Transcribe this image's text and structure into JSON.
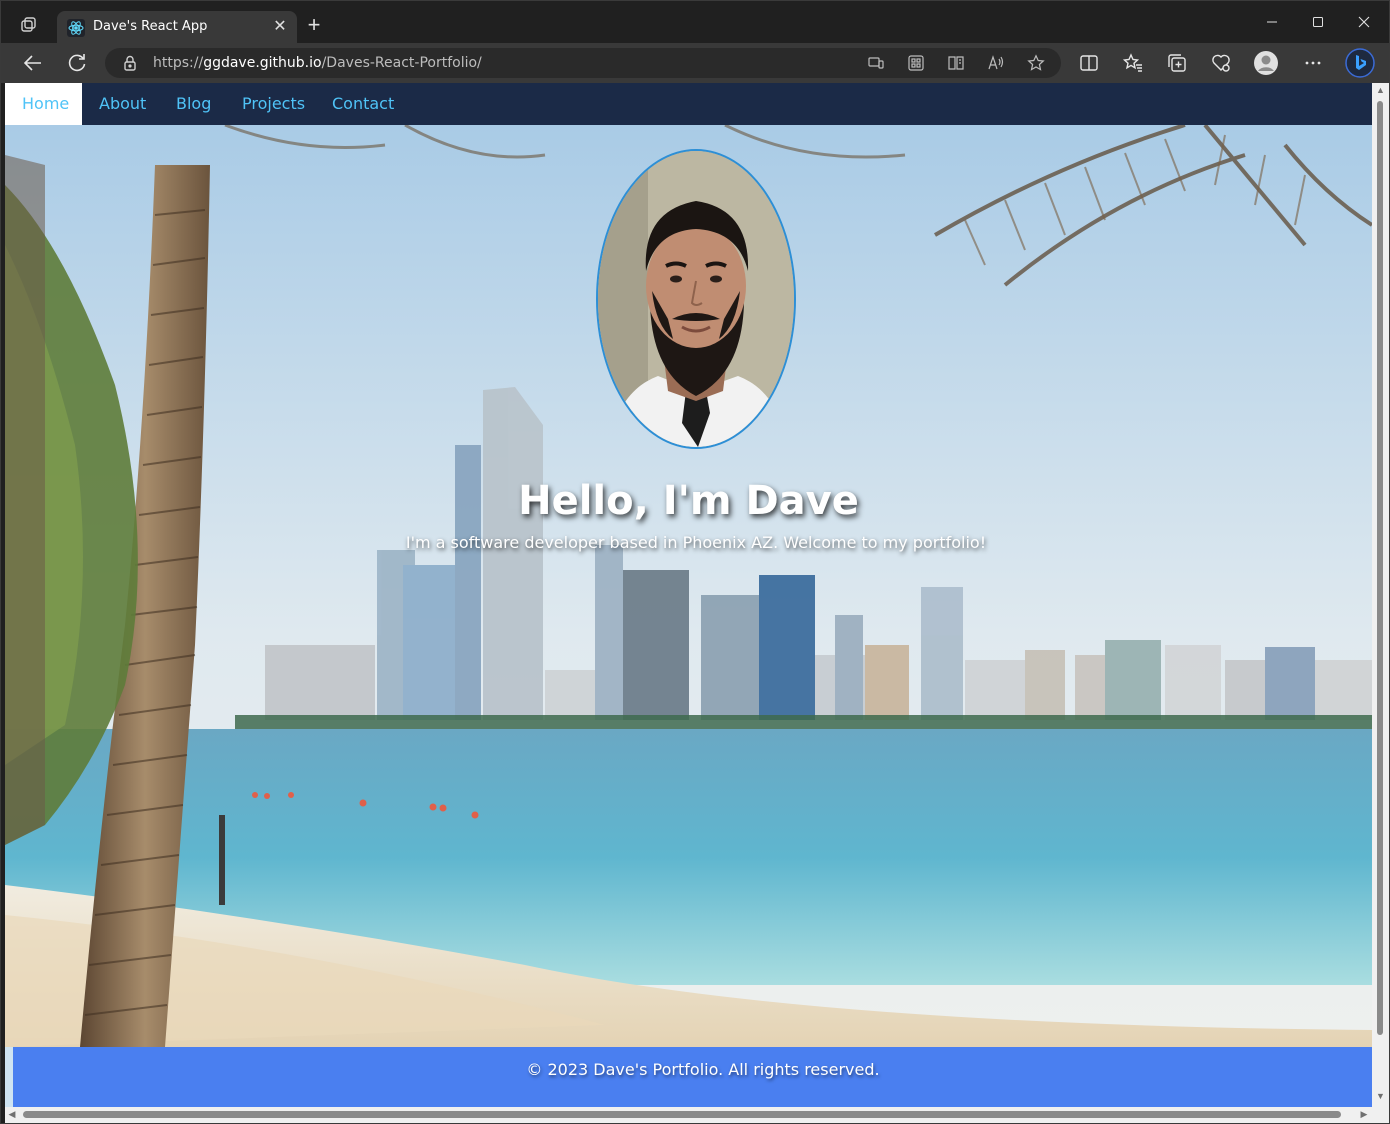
{
  "browser": {
    "tab_title": "Dave's React App",
    "url_prefix": "https://",
    "url_host": "ggdave.github.io",
    "url_path": "/Daves-React-Portfolio/",
    "new_tab_label": "+",
    "close_tab_label": "✕"
  },
  "nav": {
    "items": [
      {
        "label": "Home",
        "active": true
      },
      {
        "label": "About"
      },
      {
        "label": "Blog"
      },
      {
        "label": "Projects"
      },
      {
        "label": "Contact"
      }
    ]
  },
  "hero": {
    "heading": "Hello, I'm Dave",
    "subheading": "I'm a software developer based in Phoenix AZ. Welcome to my portfolio!"
  },
  "footer": {
    "text": "© 2023 Dave's Portfolio. All rights reserved."
  },
  "colors": {
    "nav_bg": "#1b2a47",
    "nav_link": "#4fc3f7",
    "footer_bg": "#4a7ff0",
    "avatar_border": "#2d8fd6"
  }
}
